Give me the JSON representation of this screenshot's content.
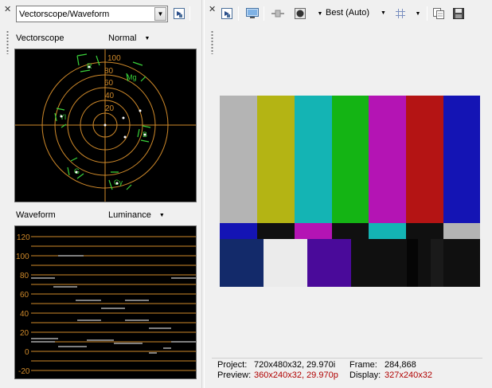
{
  "left_panel": {
    "view_select": {
      "value": "Vectorscope/Waveform"
    },
    "vectorscope": {
      "label": "Vectorscope",
      "mode": "Normal",
      "ring_labels": [
        "100",
        "80",
        "60",
        "40",
        "20"
      ],
      "targets": [
        "R",
        "Mg",
        "B",
        "Cy",
        "G",
        "Yl"
      ]
    },
    "waveform": {
      "label": "Waveform",
      "mode": "Luminance",
      "scale_labels": [
        "120",
        "100",
        "80",
        "60",
        "40",
        "20",
        "0",
        "-20"
      ]
    }
  },
  "right_panel": {
    "toolbar": {
      "quality_value": "Best (Auto)"
    },
    "status": {
      "project_label": "Project:",
      "project_value": "720x480x32, 29.970i",
      "frame_label": "Frame:",
      "frame_value": "284,868",
      "preview_label": "Preview:",
      "preview_value": "360x240x32, 29.970p",
      "display_label": "Display:",
      "display_value": "327x240x32"
    }
  },
  "colors": {
    "graticule": "#d08a2a",
    "target_box": "#3ad23a",
    "warning_text": "#b00000",
    "bars_top": [
      "#b4b4b4",
      "#b4b414",
      "#14b4b4",
      "#14b414",
      "#b414b4",
      "#b41414",
      "#1414b4"
    ],
    "bars_mid": [
      "#1414b4",
      "#101010",
      "#b414b4",
      "#101010",
      "#14b4b4",
      "#101010",
      "#b4b4b4"
    ],
    "bars_bottom": [
      "#132a6a",
      "#ebebeb",
      "#4a0a9a",
      "#101010",
      "#101010",
      "#050505",
      "#1a1a1a",
      "#101010"
    ]
  },
  "icons": [
    "close-icon",
    "pin-icon",
    "monitor-icon",
    "split-icon",
    "overlay-icon",
    "grid-icon",
    "copy-icon",
    "save-icon"
  ]
}
